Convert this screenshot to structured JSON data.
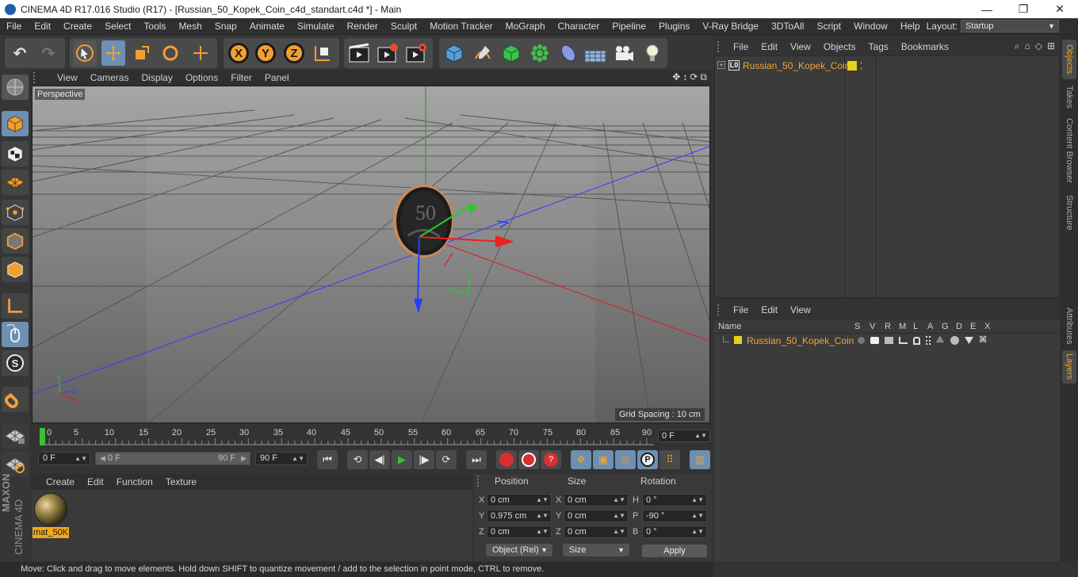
{
  "window": {
    "title": "CINEMA 4D R17.016 Studio (R17) - [Russian_50_Kopek_Coin_c4d_standart.c4d *] - Main",
    "controls": [
      "—",
      "❐",
      "✕"
    ]
  },
  "menubar": {
    "items": [
      "File",
      "Edit",
      "Create",
      "Select",
      "Tools",
      "Mesh",
      "Snap",
      "Animate",
      "Simulate",
      "Render",
      "Sculpt",
      "Motion Tracker",
      "MoGraph",
      "Character",
      "Pipeline",
      "Plugins",
      "V-Ray Bridge",
      "3DToAll",
      "Script",
      "Window",
      "Help"
    ],
    "layout_label": "Layout:",
    "layout_value": "Startup"
  },
  "toolbar": {
    "axis_x": "X",
    "axis_y": "Y",
    "axis_z": "Z"
  },
  "viewport": {
    "menu": [
      "View",
      "Cameras",
      "Display",
      "Options",
      "Filter",
      "Panel"
    ],
    "camera_label": "Perspective",
    "grid_spacing": "Grid Spacing : 10 cm",
    "coin_text": "50"
  },
  "timeline": {
    "ticks": [
      "0",
      "5",
      "10",
      "15",
      "20",
      "25",
      "30",
      "35",
      "40",
      "45",
      "50",
      "55",
      "60",
      "65",
      "70",
      "75",
      "80",
      "85",
      "90"
    ],
    "current_frame": "0 F",
    "start_field": "0 F",
    "range_start": "0 F",
    "range_end": "90 F",
    "end_field": "90 F"
  },
  "material_manager": {
    "menu": [
      "Create",
      "Edit",
      "Function",
      "Texture"
    ],
    "material_name": "mat_50K"
  },
  "coordinates": {
    "headers": {
      "position": "Position",
      "size": "Size",
      "rotation": "Rotation"
    },
    "position": {
      "x": "0 cm",
      "y": "0.975 cm",
      "z": "0 cm"
    },
    "size": {
      "x": "0 cm",
      "y": "0 cm",
      "z": "0 cm"
    },
    "rotation": {
      "h": "0 °",
      "p": "-90 °",
      "b": "0 °"
    },
    "axis_labels": {
      "x": "X",
      "y": "Y",
      "z": "Z",
      "h": "H",
      "p": "P",
      "b": "B"
    },
    "mode_dropdown": "Object (Rel)",
    "size_dropdown": "Size",
    "apply": "Apply"
  },
  "statusbar": {
    "text": "Move: Click and drag to move elements. Hold down SHIFT to quantize movement / add to the selection in point mode, CTRL to remove."
  },
  "object_manager": {
    "menu": [
      "File",
      "Edit",
      "View",
      "Objects",
      "Tags",
      "Bookmarks"
    ],
    "objects": [
      {
        "name": "Russian_50_Kopek_Coin",
        "layer_color": "#e6d21e"
      }
    ]
  },
  "layers_manager": {
    "menu": [
      "File",
      "Edit",
      "View"
    ],
    "columns": [
      "Name",
      "S",
      "V",
      "R",
      "M",
      "L",
      "A",
      "G",
      "D",
      "E",
      "X"
    ],
    "layers": [
      {
        "name": "Russian_50_Kopek_Coin",
        "color": "#e6d21e"
      }
    ]
  },
  "side_tabs": [
    "Objects",
    "Takes",
    "Content Browser",
    "Structure",
    "Attributes",
    "Layers"
  ],
  "brand": {
    "line1": "MAXON",
    "line2": "CINEMA 4D"
  },
  "colors": {
    "accent_orange": "#f2a33a",
    "active_blue": "#6d8fb3",
    "axis_x": "#e02020",
    "axis_y": "#20c020",
    "axis_z": "#2040e0"
  }
}
